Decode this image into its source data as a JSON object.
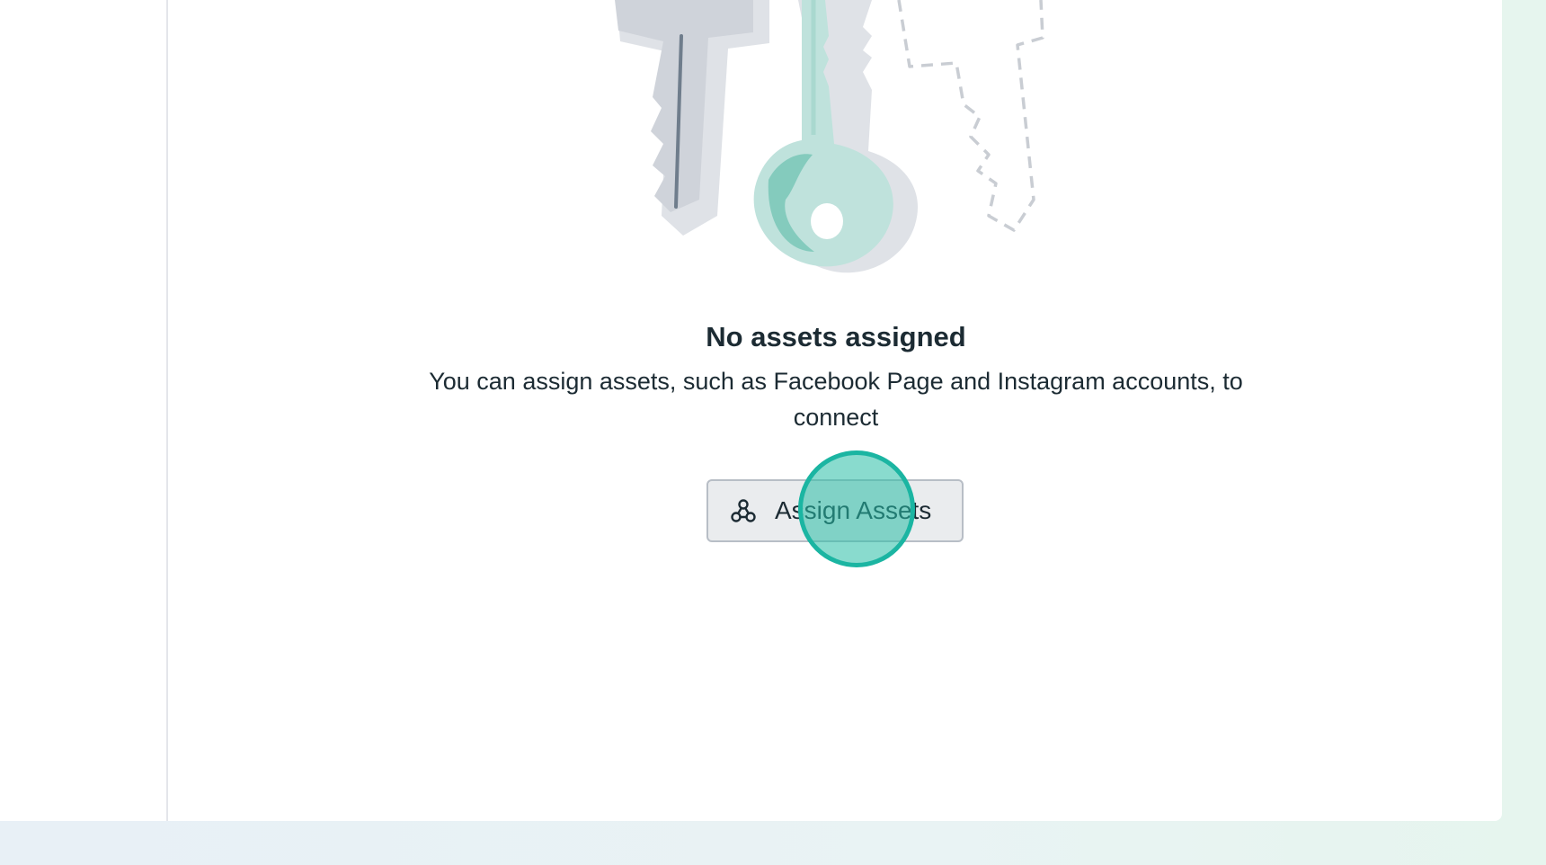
{
  "empty_state": {
    "title": "No assets assigned",
    "description": "You can assign assets, such as Facebook Page and Instagram accounts, to connect",
    "illustration": "keys-illustration"
  },
  "assign_button": {
    "label": "Assign Assets",
    "icon": "assets-network-icon"
  },
  "colors": {
    "text_primary": "#1c2b33",
    "button_background": "#eaecee",
    "button_border": "#b8bec6",
    "key_teal": "#bfe2dc",
    "key_gray": "#cfd3da",
    "click_indicator": "#1bb5a2"
  }
}
